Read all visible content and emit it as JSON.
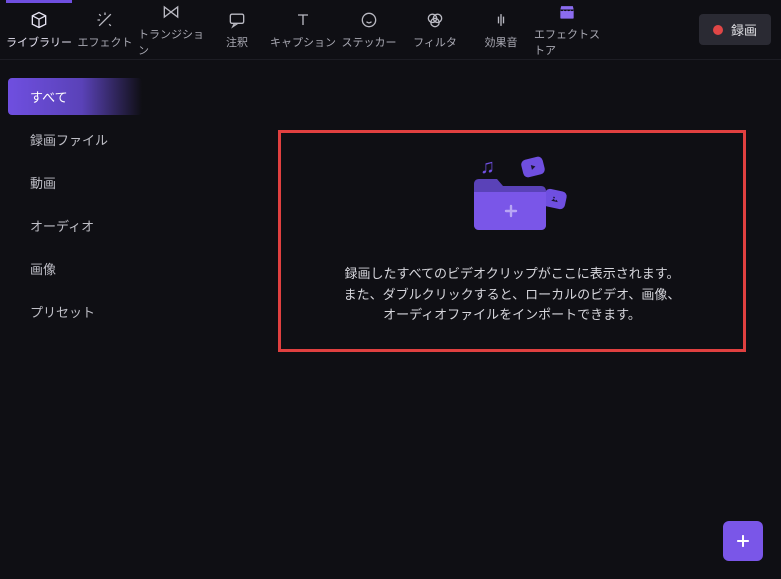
{
  "topbar": {
    "tabs": [
      {
        "id": "library",
        "label": "ライブラリー"
      },
      {
        "id": "effects",
        "label": "エフェクト"
      },
      {
        "id": "transition",
        "label": "トランジション"
      },
      {
        "id": "annotate",
        "label": "注釈"
      },
      {
        "id": "caption",
        "label": "キャプション"
      },
      {
        "id": "sticker",
        "label": "ステッカー"
      },
      {
        "id": "filter",
        "label": "フィルタ"
      },
      {
        "id": "sound",
        "label": "効果音"
      },
      {
        "id": "store",
        "label": "エフェクトストア"
      }
    ],
    "active_tab": "library",
    "record_label": "録画"
  },
  "sidebar": {
    "items": [
      {
        "id": "all",
        "label": "すべて"
      },
      {
        "id": "recfile",
        "label": "録画ファイル"
      },
      {
        "id": "video",
        "label": "動画"
      },
      {
        "id": "audio",
        "label": "オーディオ"
      },
      {
        "id": "image",
        "label": "画像"
      },
      {
        "id": "preset",
        "label": "プリセット"
      }
    ],
    "active_item": "all"
  },
  "dropzone": {
    "text": "録画したすべてのビデオクリップがここに表示されます。また、ダブルクリックすると、ローカルのビデオ、画像、オーディオファイルをインポートできます。"
  },
  "fab": {
    "label": "add"
  },
  "colors": {
    "accent": "#6f4fe0",
    "record": "#e04646",
    "highlight_border": "#e04040",
    "bg": "#0f0f14"
  }
}
